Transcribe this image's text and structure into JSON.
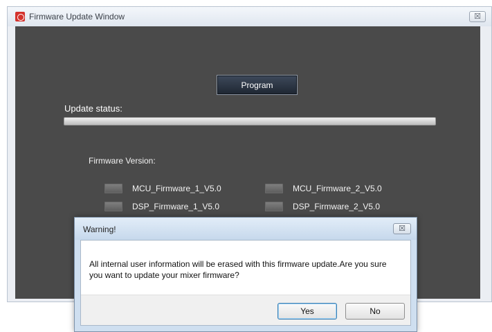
{
  "main_window": {
    "title": "Firmware Update Window",
    "close_glyph": "☒"
  },
  "program_button": {
    "label": "Program"
  },
  "update_status": {
    "label": "Update status:",
    "progress_percent": 0
  },
  "firmware": {
    "label": "Firmware Version:",
    "items": [
      {
        "name": "MCU_Firmware_1_V5.0"
      },
      {
        "name": "MCU_Firmware_2_V5.0"
      },
      {
        "name": "DSP_Firmware_1_V5.0"
      },
      {
        "name": "DSP_Firmware_2_V5.0"
      }
    ]
  },
  "warning_dialog": {
    "title": "Warning!",
    "close_glyph": "☒",
    "message": "All internal user information will be erased with this firmware update.Are you sure you want to update your mixer firmware?",
    "yes_label": "Yes",
    "no_label": "No"
  },
  "colors": {
    "content_background": "#4a4a4a",
    "titlebar": "#dfe6ef",
    "dialog_frame": "#cfdff0",
    "accent_focus": "#3c7fb1",
    "app_icon": "#d4332d"
  },
  "icons": {
    "app": "app-logo-icon",
    "close": "close-icon"
  }
}
